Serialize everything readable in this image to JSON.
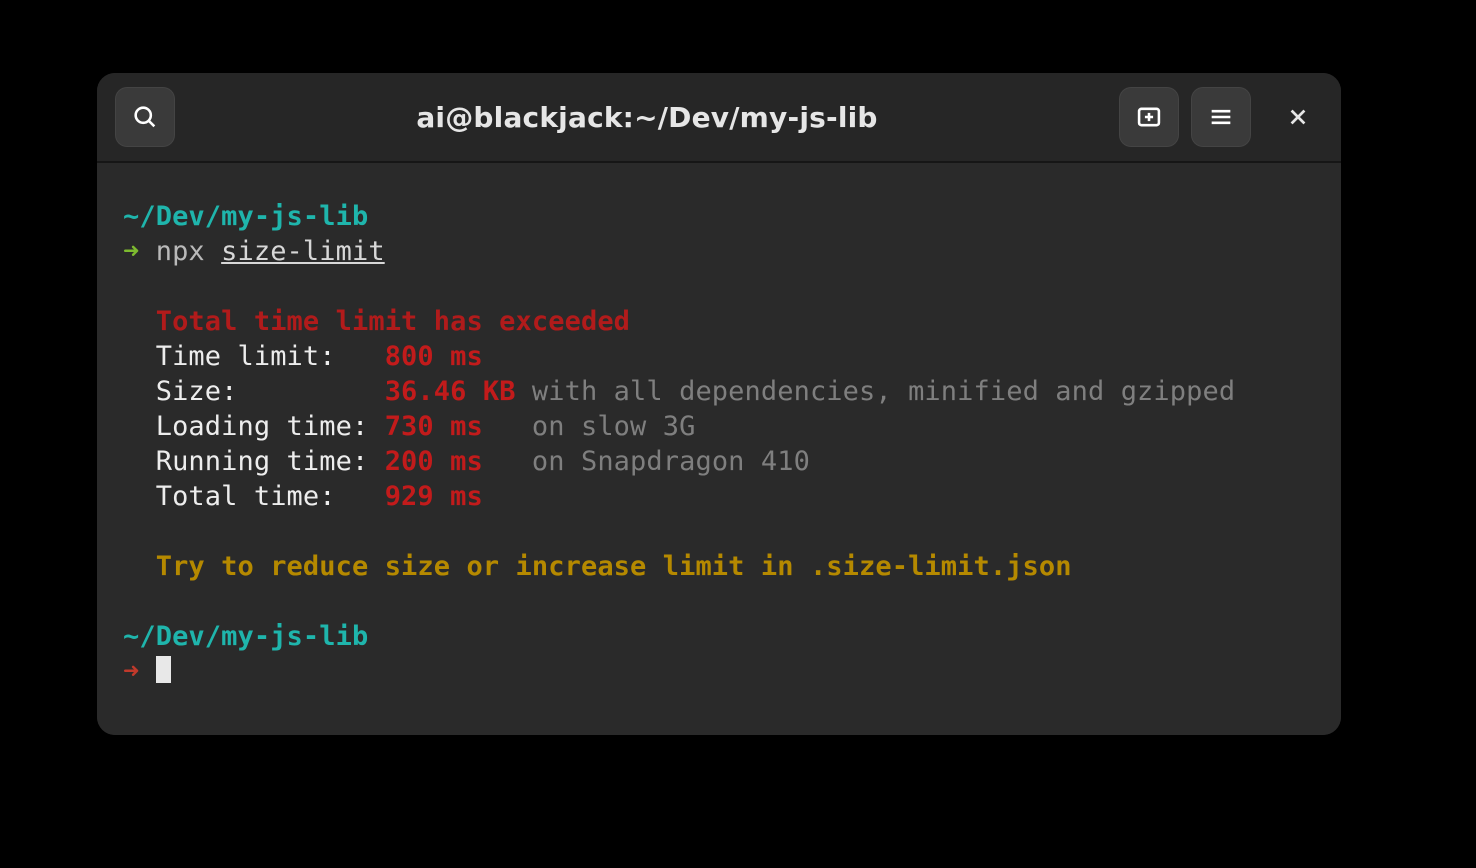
{
  "window": {
    "title": "ai@blackjack:~/Dev/my-js-lib"
  },
  "prompt": {
    "path": "~/Dev/my-js-lib",
    "arrow": "➜",
    "cmd_prefix": "npx ",
    "cmd_name": "size-limit"
  },
  "output": {
    "headline": "Total time limit has exceeded",
    "rows": {
      "time_limit": {
        "label": "Time limit:   ",
        "value": "800 ms"
      },
      "size": {
        "label": "Size:         ",
        "value": "36.46 KB",
        "note": " with all dependencies, minified and gzipped"
      },
      "loading": {
        "label": "Loading time: ",
        "value": "730 ms",
        "note": "   on slow 3G"
      },
      "running": {
        "label": "Running time: ",
        "value": "200 ms",
        "note": "   on Snapdragon 410"
      },
      "total": {
        "label": "Total time:   ",
        "value": "929 ms"
      }
    },
    "tip_pre": "Try to reduce size or increase limit in ",
    "tip_strong": ".size-limit.json"
  }
}
